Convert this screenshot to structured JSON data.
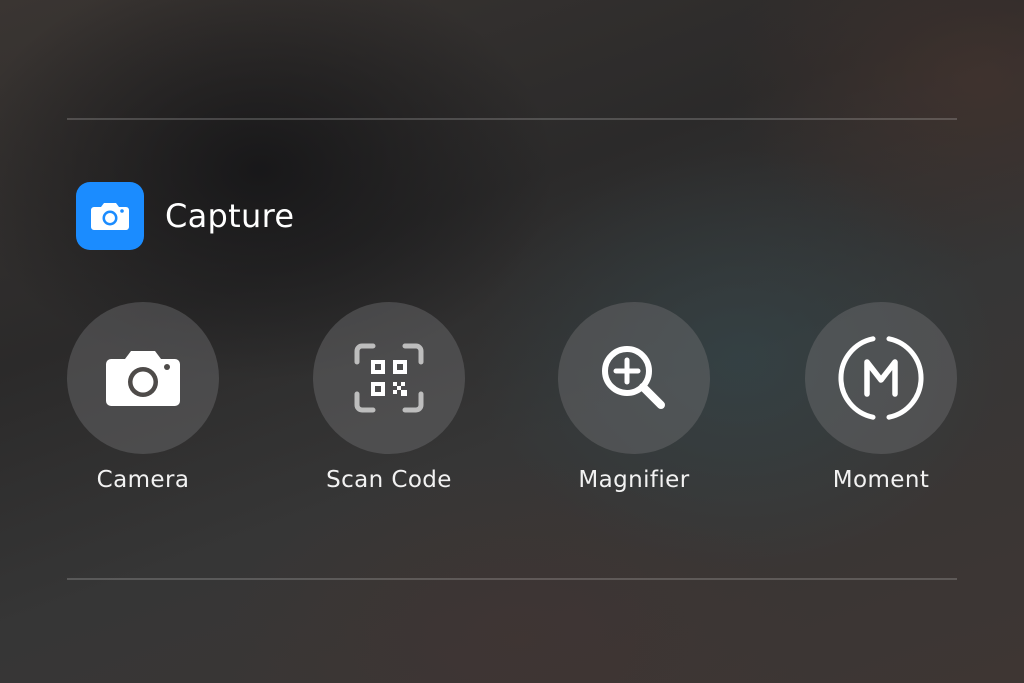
{
  "section": {
    "title": "Capture",
    "icon": "camera-icon",
    "icon_color": "#1b8cff"
  },
  "controls": [
    {
      "label": "Camera",
      "icon": "camera-icon"
    },
    {
      "label": "Scan Code",
      "icon": "qr-code-scan-icon"
    },
    {
      "label": "Magnifier",
      "icon": "magnifier-plus-icon"
    },
    {
      "label": "Moment",
      "icon": "moment-m-icon"
    }
  ]
}
